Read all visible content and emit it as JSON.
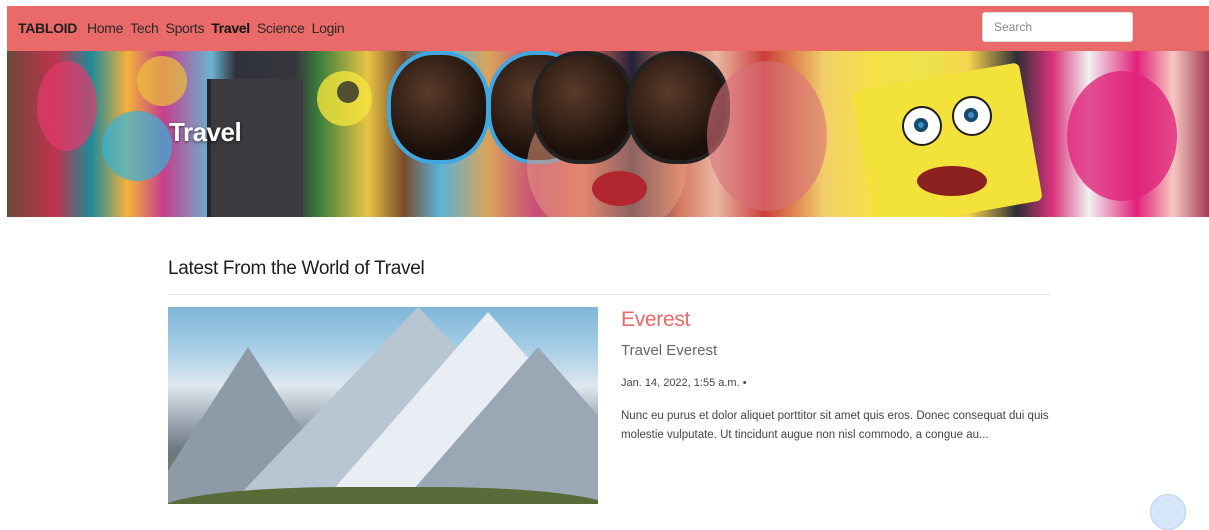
{
  "navbar": {
    "brand": "TABLOID",
    "items": [
      {
        "label": "Home",
        "active": false
      },
      {
        "label": "Tech",
        "active": false
      },
      {
        "label": "Sports",
        "active": false
      },
      {
        "label": "Travel",
        "active": true
      },
      {
        "label": "Science",
        "active": false
      },
      {
        "label": "Login",
        "active": false
      }
    ],
    "search_placeholder": "Search",
    "search_value": ""
  },
  "hero": {
    "title": "Travel"
  },
  "main": {
    "section_title": "Latest From the World of Travel",
    "post": {
      "title": "Everest",
      "subtitle": "Travel Everest",
      "meta": "Jan. 14, 2022, 1:55 a.m. •",
      "excerpt": "Nunc eu purus et dolor aliquet porttitor sit amet quis eros. Donec consequat dui quis molestie vulputate. Ut tincidunt augue non nisl commodo, a congue au..."
    }
  },
  "colors": {
    "accent": "#e96a69",
    "text": "#1d1d1d",
    "muted": "#666666"
  }
}
